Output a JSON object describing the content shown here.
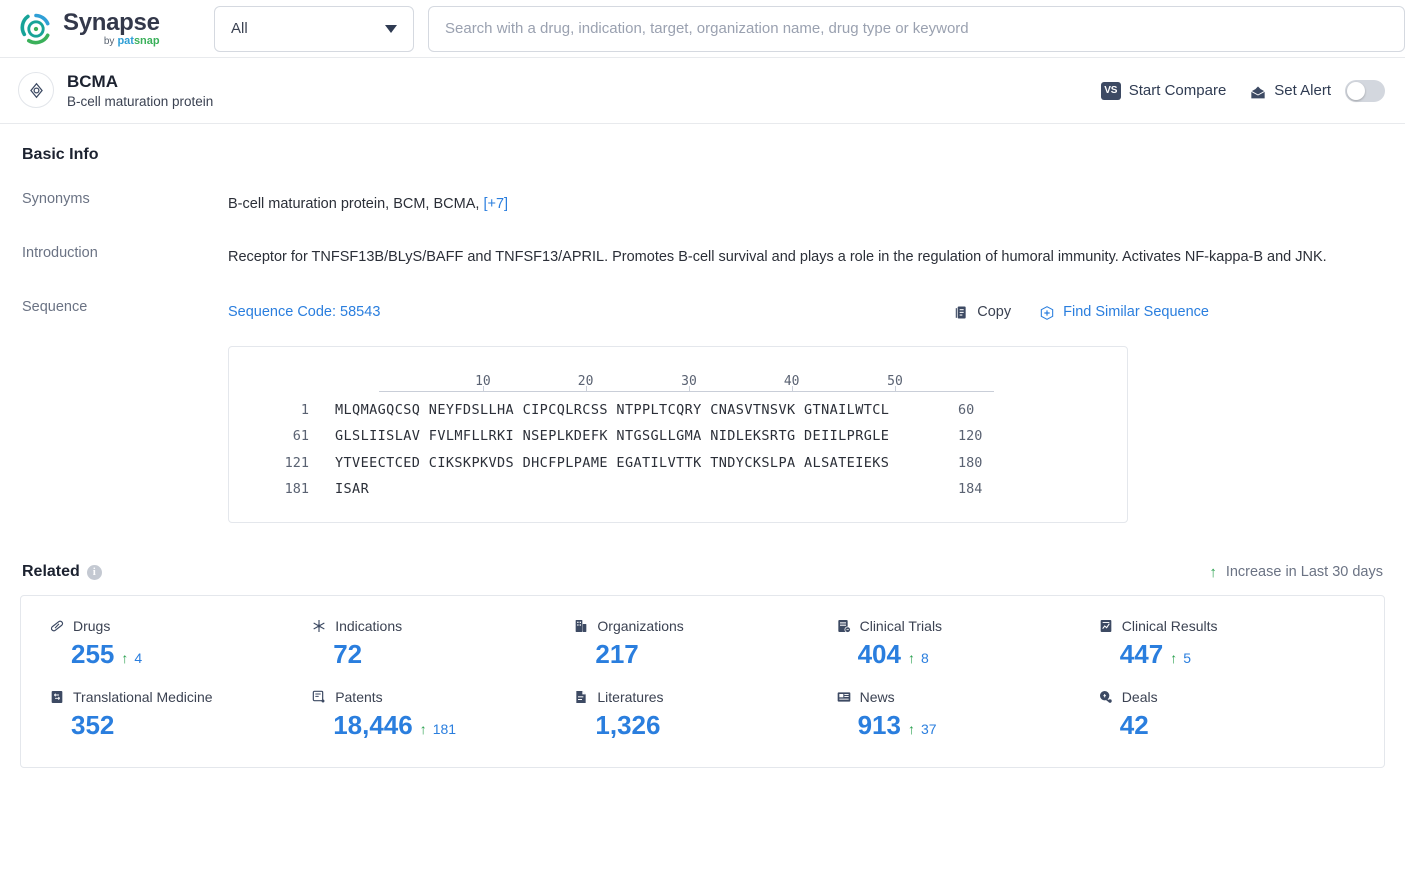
{
  "brand": {
    "name": "Synapse",
    "by": "by",
    "pat": "pat",
    "snap": "snap",
    "logo_teal": "#17a398",
    "logo_green": "#3ab05a",
    "logo_blue": "#2f9fd6"
  },
  "search": {
    "category_selected": "All",
    "placeholder": "Search with a drug, indication, target, organization name, drug type or keyword",
    "value": ""
  },
  "entity": {
    "name": "BCMA",
    "subtitle": "B-cell maturation protein",
    "start_compare": "Start Compare",
    "vs_badge": "VS",
    "set_alert": "Set Alert",
    "alert_enabled": false
  },
  "basic_info": {
    "heading": "Basic Info",
    "rows": [
      {
        "label": "Synonyms",
        "value": "B-cell maturation protein, BCM, BCMA,",
        "more": "[+7]"
      },
      {
        "label": "Introduction",
        "value": "Receptor for TNFSF13B/BLyS/BAFF and TNFSF13/APRIL. Promotes B-cell survival and plays a role in the regulation of humoral immunity. Activates NF-kappa-B and JNK."
      },
      {
        "label": "Sequence"
      }
    ]
  },
  "sequence": {
    "code_label": "Sequence Code: 58543",
    "copy_label": "Copy",
    "find_similar_label": "Find Similar Sequence",
    "ruler_ticks": [
      10,
      20,
      30,
      40,
      50
    ],
    "lines": [
      {
        "start": "1",
        "residues": "MLQMAGQCSQ NEYFDSLLHA CIPCQLRCSS NTPPLTCQRY CNASVTNSVK GTNAILWTCL",
        "end": "60"
      },
      {
        "start": "61",
        "residues": "GLSLIISLAV FVLMFLLRKI NSEPLKDEFK NTGSGLLGMA NIDLEKSRTG DEIILPRGLE",
        "end": "120"
      },
      {
        "start": "121",
        "residues": "YTVEECTCED CIKSKPKVDS DHCFPLPAME EGATILVTTK TNDYCKSLPA ALSATEIEKS",
        "end": "180"
      },
      {
        "start": "181",
        "residues": "ISAR",
        "end": "184"
      }
    ]
  },
  "related": {
    "heading": "Related",
    "legend": "Increase in Last 30 days",
    "accent_blue": "#2a7ede",
    "increase_green": "#2aa14f",
    "stats": [
      {
        "icon": "capsule-icon",
        "label": "Drugs",
        "value": "255",
        "delta": "4"
      },
      {
        "icon": "snowflake-icon",
        "label": "Indications",
        "value": "72",
        "delta": ""
      },
      {
        "icon": "building-icon",
        "label": "Organizations",
        "value": "217",
        "delta": ""
      },
      {
        "icon": "clinical-trial-icon",
        "label": "Clinical Trials",
        "value": "404",
        "delta": "8"
      },
      {
        "icon": "clinical-result-icon",
        "label": "Clinical Results",
        "value": "447",
        "delta": "5"
      },
      {
        "icon": "translational-icon",
        "label": "Translational Medicine",
        "value": "352",
        "delta": ""
      },
      {
        "icon": "patent-icon",
        "label": "Patents",
        "value": "18,446",
        "delta": "181"
      },
      {
        "icon": "literature-icon",
        "label": "Literatures",
        "value": "1,326",
        "delta": ""
      },
      {
        "icon": "news-icon",
        "label": "News",
        "value": "913",
        "delta": "37"
      },
      {
        "icon": "deals-icon",
        "label": "Deals",
        "value": "42",
        "delta": ""
      }
    ]
  }
}
